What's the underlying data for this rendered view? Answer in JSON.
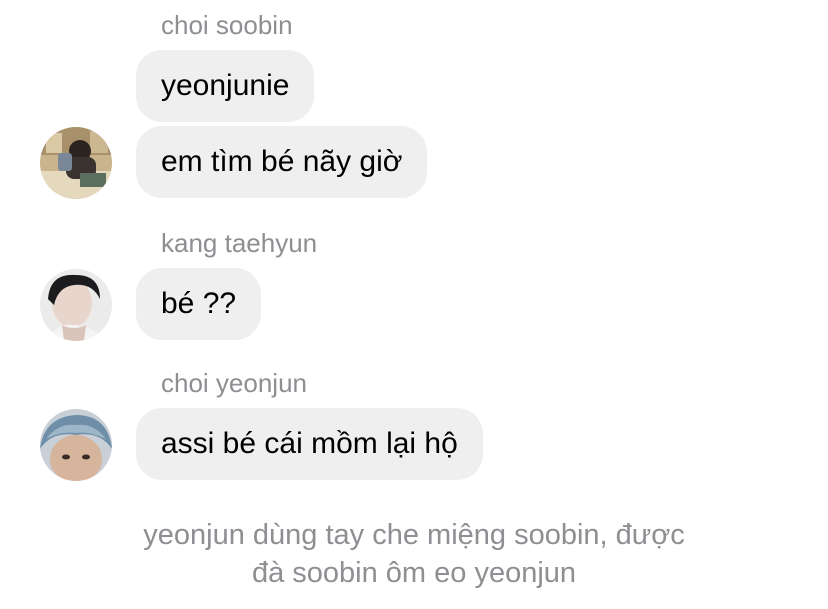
{
  "messages": [
    {
      "sender": "choi soobin",
      "bubbles": [
        "yeonjunie",
        "em tìm bé nãy giờ"
      ],
      "avatar": "soobin-avatar-photo"
    },
    {
      "sender": "kang taehyun",
      "bubbles": [
        "bé ??"
      ],
      "avatar": "taehyun-avatar-photo"
    },
    {
      "sender": "choi yeonjun",
      "bubbles": [
        "assi bé cái mồm lại hộ"
      ],
      "avatar": "yeonjun-avatar-photo"
    }
  ],
  "narration": {
    "line1": "yeonjun dùng tay che miệng soobin, được",
    "line2": "đà soobin ôm eo yeonjun"
  },
  "colors": {
    "bubble_bg": "#efefef",
    "sender_text": "#8e8e93",
    "message_text": "#000000"
  }
}
